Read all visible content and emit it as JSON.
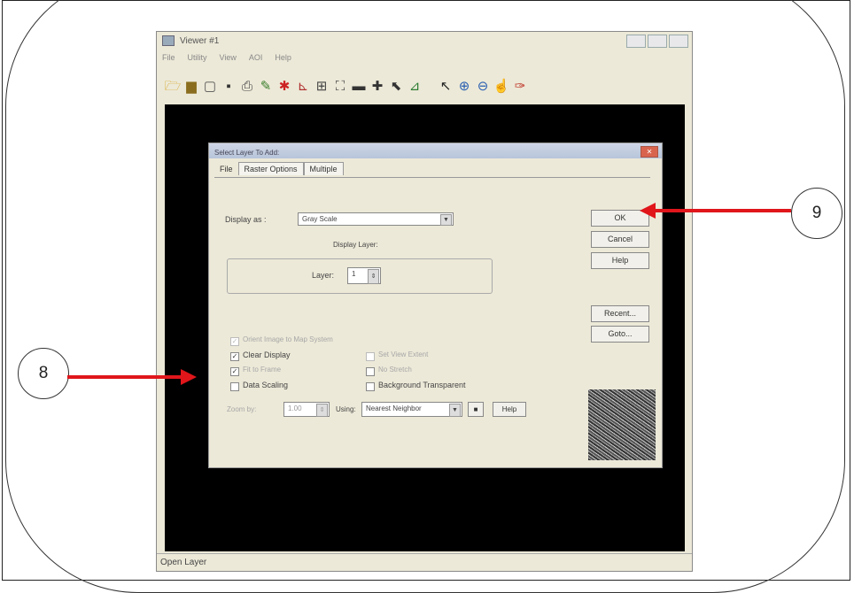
{
  "window": {
    "title": "Viewer #1",
    "menu": [
      "File",
      "Utility",
      "View",
      "AOI",
      "Help"
    ],
    "toolbar": [
      {
        "icon": "open-layer-icon",
        "glyph": "🗁",
        "color": "#d4a017"
      },
      {
        "icon": "open-folder-icon",
        "glyph": "▆",
        "color": "#8a6d1e"
      },
      {
        "icon": "new-icon",
        "glyph": "▢",
        "color": "#555555"
      },
      {
        "icon": "save-icon",
        "glyph": "▪",
        "color": "#333333"
      },
      {
        "icon": "print-icon",
        "glyph": "⎙",
        "color": "#444444"
      },
      {
        "icon": "brush-icon",
        "glyph": "✎",
        "color": "#3a7d2a"
      },
      {
        "icon": "info-icon",
        "glyph": "✱",
        "color": "#cc2222"
      },
      {
        "icon": "measure-icon",
        "glyph": "⊾",
        "color": "#b03030"
      },
      {
        "icon": "grid-icon",
        "glyph": "⊞",
        "color": "#444444"
      },
      {
        "icon": "fit-icon",
        "glyph": "⛶",
        "color": "#444444"
      },
      {
        "icon": "line-icon",
        "glyph": "▬",
        "color": "#333333"
      },
      {
        "icon": "crosshair-icon",
        "glyph": "✚",
        "color": "#333333"
      },
      {
        "icon": "tool-icon",
        "glyph": "⬉",
        "color": "#333333"
      },
      {
        "icon": "chart-icon",
        "glyph": "⊿",
        "color": "#2e7d32"
      },
      {
        "icon": "select-arrow-icon",
        "glyph": "↖",
        "color": "#222222"
      },
      {
        "icon": "zoom-in-icon",
        "glyph": "⊕",
        "color": "#2a5fb0"
      },
      {
        "icon": "zoom-out-icon",
        "glyph": "⊖",
        "color": "#2a5fb0"
      },
      {
        "icon": "pan-hand-icon",
        "glyph": "☝",
        "color": "#666666"
      },
      {
        "icon": "pin-icon",
        "glyph": "✑",
        "color": "#c0392b"
      }
    ],
    "status": "Open Layer"
  },
  "dialog": {
    "title": "Select Layer To Add:",
    "tabs": [
      "File",
      "Raster Options",
      "Multiple"
    ],
    "display_as_label": "Display as :",
    "display_as_value": "Gray Scale",
    "display_layer_label": "Display Layer:",
    "layer_label": "Layer:",
    "layer_value": "1",
    "buttons": {
      "ok": "OK",
      "cancel": "Cancel",
      "help": "Help",
      "recent": "Recent...",
      "goto": "Goto..."
    },
    "options": {
      "orient_map": "Orient Image to Map System",
      "clear_display": "Clear Display",
      "fit_to_frame": "Fit to Frame",
      "data_scaling": "Data Scaling",
      "set_view_extent": "Set View Extent",
      "no_stretch": "No Stretch",
      "background_transparent": "Background Transparent"
    },
    "zoom_label": "Zoom by:",
    "zoom_value": "1.00",
    "using_label": "Using:",
    "using_value": "Nearest Neighbor",
    "small_help": "Help"
  },
  "callouts": {
    "step8": "8",
    "step9": "9",
    "arrow_color": "#e0161b"
  }
}
